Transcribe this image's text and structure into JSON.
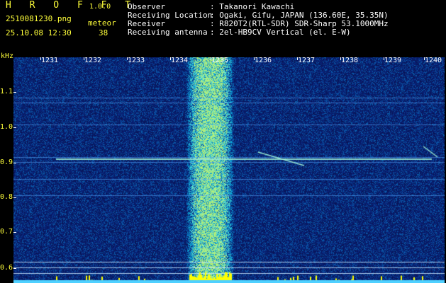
{
  "app": {
    "logo": "H R O F F T",
    "version": "1.0.0"
  },
  "file": {
    "name": "2510081230.png",
    "datetime": "25.10.08 12:30"
  },
  "meteor": {
    "label": "meteor",
    "count": "38"
  },
  "info": [
    {
      "label": "Observer",
      "value": ": Takanori Kawachi"
    },
    {
      "label": "Receiving Location",
      "value": ": Ogaki, Gifu, JAPAN (136.60E, 35.35N)"
    },
    {
      "label": "Receiver",
      "value": ": R820T2(RTL-SDR) SDR-Sharp 53.1000MHz"
    },
    {
      "label": "Receiving antenna",
      "value": ": 2el-HB9CV Vertical (el. E-W)"
    }
  ],
  "axis": {
    "y_unit": "kHz",
    "x_ticks": [
      "1231",
      "1232",
      "1233",
      "1234",
      "1235",
      "1236",
      "1237",
      "1238",
      "1239",
      "1240"
    ],
    "y_ticks": [
      "1.1",
      "1.0",
      "0.9",
      "0.8",
      "0.7",
      "0.6"
    ]
  },
  "colors": {
    "background": "#000000",
    "label_yellow": "#ffff3a",
    "spectrum_base": "#0a1a66",
    "activity_bars": "#ffff00"
  }
}
